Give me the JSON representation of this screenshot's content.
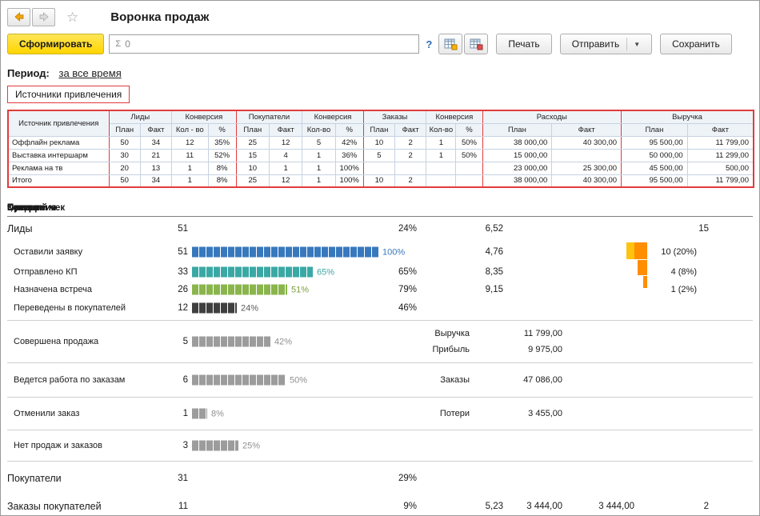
{
  "window": {
    "title": "Воронка продаж"
  },
  "toolbar": {
    "generate_label": "Сформировать",
    "sum_prefix": "Σ",
    "sum_value": "0",
    "help_label": "?",
    "print_label": "Печать",
    "send_label": "Отправить",
    "save_label": "Сохранить"
  },
  "period": {
    "label": "Период:",
    "value": "за все время"
  },
  "sources": {
    "box_label": "Источники привлечения",
    "table": {
      "col0": "Источник привлечения",
      "groups": [
        {
          "label": "Лиды",
          "sub": [
            "План",
            "Факт"
          ]
        },
        {
          "label": "Конверсия",
          "sub": [
            "Кол - во",
            "%"
          ]
        },
        {
          "label": "Покупатели",
          "sub": [
            "План",
            "Факт"
          ]
        },
        {
          "label": "Конверсия",
          "sub": [
            "Кол-во",
            "%"
          ]
        },
        {
          "label": "Заказы",
          "sub": [
            "План",
            "Факт"
          ]
        },
        {
          "label": "Конверсия",
          "sub": [
            "Кол-во",
            "%"
          ]
        },
        {
          "label": "Расходы",
          "sub": [
            "План",
            "Факт"
          ]
        },
        {
          "label": "Выручка",
          "sub": [
            "План",
            "Факт"
          ]
        }
      ],
      "rows": [
        [
          "Оффлайн реклама",
          "50",
          "34",
          "12",
          "35%",
          "25",
          "12",
          "5",
          "42%",
          "10",
          "2",
          "1",
          "50%",
          "38 000,00",
          "40 300,00",
          "95 500,00",
          "11 799,00"
        ],
        [
          "Выставка интершарм",
          "30",
          "21",
          "11",
          "52%",
          "15",
          "4",
          "1",
          "36%",
          "5",
          "2",
          "1",
          "50%",
          "15 000,00",
          "",
          "50 000,00",
          "11 299,00"
        ],
        [
          "Реклама на тв",
          "20",
          "13",
          "1",
          "8%",
          "10",
          "1",
          "1",
          "100%",
          "",
          "",
          "",
          "",
          "23 000,00",
          "25 300,00",
          "45 500,00",
          "500,00"
        ],
        [
          "Итого",
          "50",
          "34",
          "1",
          "8%",
          "25",
          "12",
          "1",
          "100%",
          "10",
          "2",
          "",
          "",
          "38 000,00",
          "40 300,00",
          "95 500,00",
          "11 799,00"
        ]
      ]
    }
  },
  "funnel": {
    "headers": [
      "Состояние",
      "Кол-во",
      "Конверсия",
      "t, ч.",
      "Сумма",
      "Средний чек",
      "Потери"
    ],
    "rows": [
      {
        "type": "section",
        "label": "Лиды",
        "count": "51",
        "conv": "24%",
        "t": "6,52",
        "loss": "15"
      },
      {
        "type": "item",
        "label": "Оставили заявку",
        "count": "51",
        "bar": {
          "pct": 100,
          "color": "blue",
          "label": "100%"
        },
        "t": "4,76",
        "loss2": "10 (20%)"
      },
      {
        "type": "item",
        "label": "Отправлено КП",
        "count": "33",
        "bar": {
          "pct": 65,
          "color": "teal",
          "label": "65%"
        },
        "conv": "65%",
        "t": "8,35",
        "loss2": "4 (8%)"
      },
      {
        "type": "item",
        "label": "Назначена встреча",
        "count": "26",
        "bar": {
          "pct": 51,
          "color": "green",
          "label": "51%"
        },
        "conv": "79%",
        "t": "9,15",
        "loss2": "1 (2%)"
      },
      {
        "type": "item",
        "label": "Переведены в покупателей",
        "count": "12",
        "bar": {
          "pct": 24,
          "color": "dark",
          "label": "24%"
        },
        "conv": "46%"
      },
      {
        "type": "item",
        "label": "Совершена продажа",
        "count": "5",
        "bar": {
          "pct": 42,
          "color": "gray",
          "label": "42%"
        },
        "sums": [
          {
            "label": "Выручка",
            "value": "11 799,00"
          },
          {
            "label": "Прибыль",
            "value": "9 975,00"
          }
        ]
      },
      {
        "type": "item",
        "label": "Ведется работа по заказам",
        "count": "6",
        "bar": {
          "pct": 50,
          "color": "gray",
          "label": "50%"
        },
        "sums": [
          {
            "label": "Заказы",
            "value": "47 086,00"
          }
        ]
      },
      {
        "type": "item",
        "label": "Отменили заказ",
        "count": "1",
        "bar": {
          "pct": 8,
          "color": "gray",
          "label": "8%"
        },
        "sums": [
          {
            "label": "Потери",
            "value": "3 455,00"
          }
        ]
      },
      {
        "type": "item",
        "label": "Нет продаж и заказов",
        "count": "3",
        "bar": {
          "pct": 25,
          "color": "gray",
          "label": "25%"
        }
      },
      {
        "type": "section",
        "label": "Покупатели",
        "count": "31",
        "conv": "29%"
      },
      {
        "type": "section",
        "label": "Заказы покупателей",
        "count": "11",
        "conv": "9%",
        "t": "5,23",
        "sum": "3 444,00",
        "avg": "3 444,00",
        "loss": "2"
      }
    ]
  },
  "colors": {
    "accent_red": "#e23b3b",
    "generate_yellow": "#ffd500",
    "bar_blue": "#3878bd",
    "bar_teal": "#3aa8a4",
    "bar_green": "#8ab54d",
    "bar_dark": "#3f3f3f",
    "bar_gray": "#9c9c9c",
    "funnel_orange": "#ff8e00",
    "funnel_yellow": "#ffc20e",
    "link_blue": "#2b6cb8"
  }
}
